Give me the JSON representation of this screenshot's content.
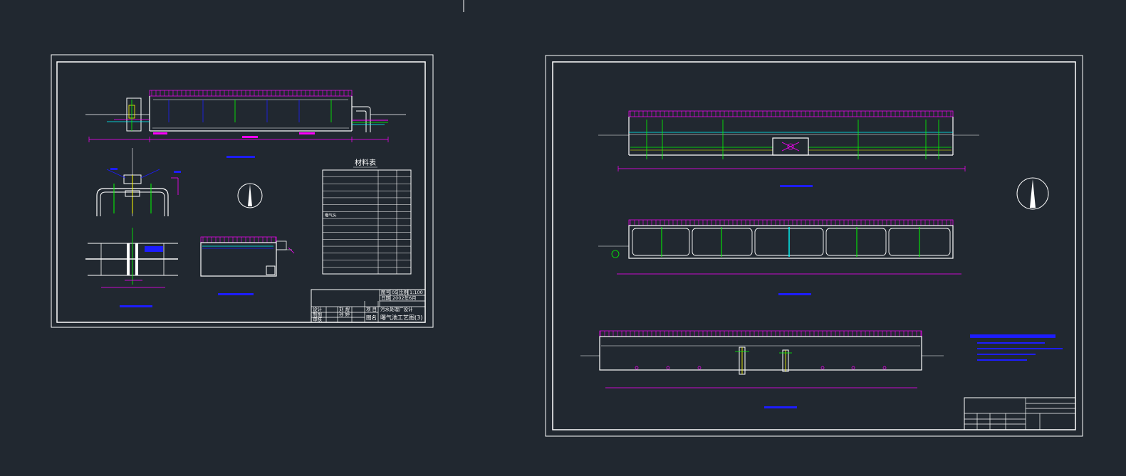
{
  "colors": {
    "background": "#212830",
    "frame": "#ffffff",
    "dimension": "#ff00ff",
    "water_pipe": "#00ff00",
    "air_pipe": "#00ffff",
    "annotation": "#1d1dff",
    "guide": "#ffff00"
  },
  "sheet_left": {
    "material_table_title": "材料表",
    "material_rows": [
      {
        "name": "",
        "spec": "",
        "qty": ""
      },
      {
        "name": "",
        "spec": "",
        "qty": ""
      },
      {
        "name": "",
        "spec": "",
        "qty": ""
      },
      {
        "name": "",
        "spec": "",
        "qty": ""
      },
      {
        "name": "",
        "spec": "",
        "qty": ""
      },
      {
        "name": "",
        "spec": "",
        "qty": ""
      },
      {
        "name": "曝气头",
        "spec": "",
        "qty": ""
      },
      {
        "name": "",
        "spec": "",
        "qty": ""
      },
      {
        "name": "",
        "spec": "",
        "qty": ""
      },
      {
        "name": "",
        "spec": "",
        "qty": ""
      },
      {
        "name": "",
        "spec": "",
        "qty": ""
      },
      {
        "name": "",
        "spec": "",
        "qty": ""
      },
      {
        "name": "",
        "spec": "",
        "qty": ""
      },
      {
        "name": "",
        "spec": "",
        "qty": ""
      },
      {
        "name": "",
        "spec": "",
        "qty": ""
      }
    ],
    "title_block": {
      "drawing_no_label": "图号",
      "drawing_no": "05",
      "scale_label": "比例",
      "scale": "1:100",
      "date_label": "日期",
      "date": "2002年6月",
      "design_label": "设计",
      "designer": "刘 煜",
      "project_label": "项 目",
      "project": "污水处理厂设计",
      "draw_label": "制图",
      "drawer": "孙 婷",
      "check_label": "审核",
      "drawing_name_label": "图名",
      "drawing_name": "曝气池工艺图(3)"
    }
  }
}
